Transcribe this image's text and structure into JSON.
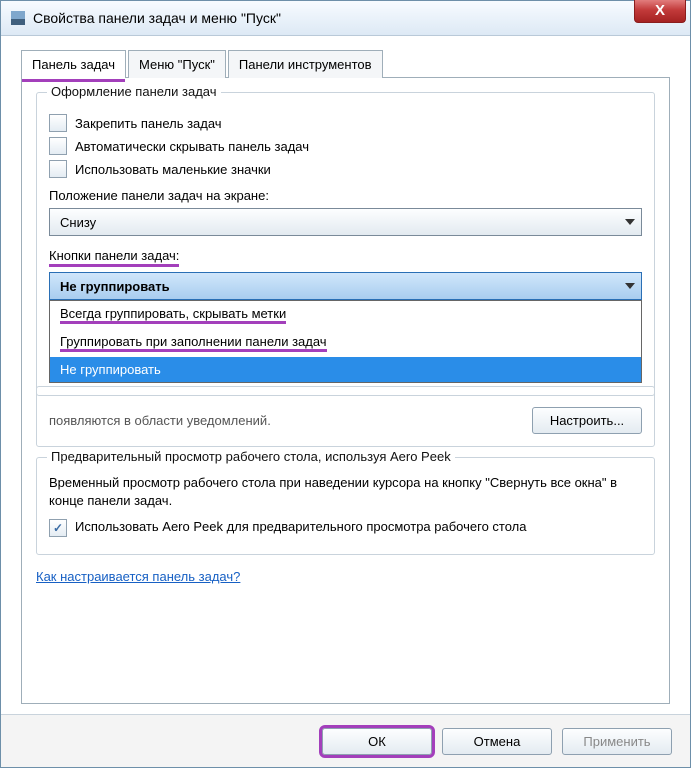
{
  "window": {
    "title": "Свойства панели задач и меню \"Пуск\""
  },
  "tabs": {
    "taskbar": "Панель задач",
    "start": "Меню \"Пуск\"",
    "toolbars": "Панели инструментов"
  },
  "groups": {
    "appearance": {
      "legend": "Оформление панели задач",
      "lock": "Закрепить панель задач",
      "autohide": "Автоматически скрывать панель задач",
      "smallicons": "Использовать маленькие значки",
      "position_label": "Положение панели задач на экране:",
      "position_value": "Снизу",
      "buttons_label": "Кнопки панели задач:",
      "buttons_value": "Не группировать",
      "options": {
        "always": "Всегда группировать, скрывать метки",
        "whenfull": "Группировать при заполнении панели задач",
        "never": "Не группировать"
      }
    },
    "notify": {
      "text_fragment": "появляются в области уведомлений.",
      "customize": "Настроить..."
    },
    "aero": {
      "legend": "Предварительный просмотр рабочего стола, используя Aero Peek",
      "text": "Временный просмотр рабочего стола при наведении курсора на кнопку \"Свернуть все окна\" в конце панели задач.",
      "checkbox": "Использовать Aero Peek для предварительного просмотра рабочего стола"
    }
  },
  "link": "Как настраивается панель задач?",
  "footer": {
    "ok": "ОК",
    "cancel": "Отмена",
    "apply": "Применить"
  }
}
